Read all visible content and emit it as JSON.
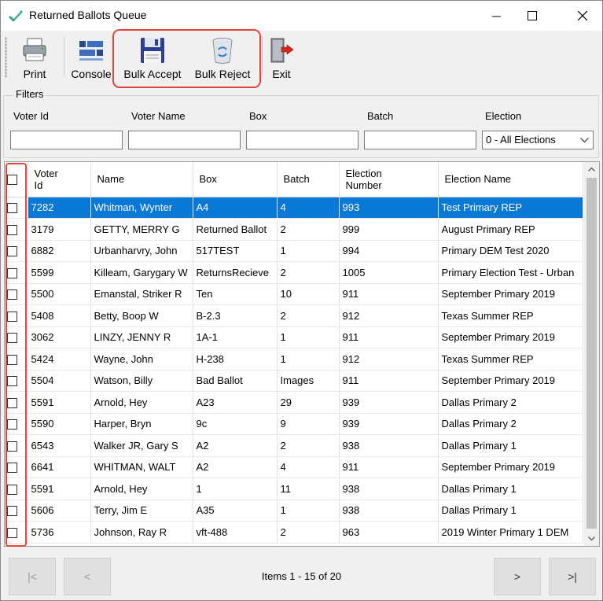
{
  "window": {
    "title": "Returned Ballots Queue"
  },
  "toolbar": {
    "print": "Print",
    "console": "Console",
    "bulk_accept": "Bulk Accept",
    "bulk_reject": "Bulk Reject",
    "exit": "Exit"
  },
  "filters": {
    "legend": "Filters",
    "voter_id_label": "Voter Id",
    "voter_name_label": "Voter Name",
    "box_label": "Box",
    "batch_label": "Batch",
    "election_label": "Election",
    "voter_id_value": "",
    "voter_name_value": "",
    "box_value": "",
    "batch_value": "",
    "election_selected": "0 - All Elections"
  },
  "grid": {
    "headers": {
      "voter_id": "Voter Id",
      "name": "Name",
      "box": "Box",
      "batch": "Batch",
      "election_number": "Election Number",
      "election_name": "Election Name"
    },
    "rows": [
      {
        "voter_id": "7282",
        "name": "Whitman, Wynter",
        "box": "A4",
        "batch": "4",
        "election_number": "993",
        "election_name": "Test Primary REP",
        "selected": true
      },
      {
        "voter_id": "3179",
        "name": "GETTY, MERRY G",
        "box": "Returned Ballot",
        "batch": "2",
        "election_number": "999",
        "election_name": "August Primary REP"
      },
      {
        "voter_id": "6882",
        "name": "Urbanharvry, John",
        "box": "517TEST",
        "batch": "1",
        "election_number": "994",
        "election_name": "Primary DEM Test 2020"
      },
      {
        "voter_id": "5599",
        "name": "Killeam, Garygary W",
        "box": "ReturnsRecieve",
        "batch": "2",
        "election_number": "1005",
        "election_name": "Primary Election Test - Urban"
      },
      {
        "voter_id": "5500",
        "name": "Emanstal, Striker R",
        "box": "Ten",
        "batch": "10",
        "election_number": "911",
        "election_name": "September Primary 2019"
      },
      {
        "voter_id": "5408",
        "name": "Betty, Boop W",
        "box": "B-2.3",
        "batch": "2",
        "election_number": "912",
        "election_name": "Texas Summer REP"
      },
      {
        "voter_id": "3062",
        "name": "LINZY, JENNY R",
        "box": "1A-1",
        "batch": "1",
        "election_number": "911",
        "election_name": "September Primary 2019"
      },
      {
        "voter_id": "5424",
        "name": "Wayne, John",
        "box": "H-238",
        "batch": "1",
        "election_number": "912",
        "election_name": "Texas Summer REP"
      },
      {
        "voter_id": "5504",
        "name": "Watson, Billy",
        "box": "Bad Ballot",
        "batch": "Images",
        "election_number": "911",
        "election_name": "September Primary 2019"
      },
      {
        "voter_id": "5591",
        "name": "Arnold, Hey",
        "box": "A23",
        "batch": "29",
        "election_number": "939",
        "election_name": "Dallas Primary 2"
      },
      {
        "voter_id": "5590",
        "name": "Harper, Bryn",
        "box": "9c",
        "batch": "9",
        "election_number": "939",
        "election_name": "Dallas Primary 2"
      },
      {
        "voter_id": "6543",
        "name": "Walker JR, Gary S",
        "box": "A2",
        "batch": "2",
        "election_number": "938",
        "election_name": "Dallas Primary 1"
      },
      {
        "voter_id": "6641",
        "name": "WHITMAN, WALT",
        "box": "A2",
        "batch": "4",
        "election_number": "911",
        "election_name": "September Primary 2019"
      },
      {
        "voter_id": "5591",
        "name": "Arnold, Hey",
        "box": "1",
        "batch": "11",
        "election_number": "938",
        "election_name": "Dallas Primary 1"
      },
      {
        "voter_id": "5606",
        "name": "Terry, Jim E",
        "box": "A35",
        "batch": "1",
        "election_number": "938",
        "election_name": "Dallas Primary 1"
      },
      {
        "voter_id": "5736",
        "name": "Johnson, Ray R",
        "box": "vft-488",
        "batch": "2",
        "election_number": "963",
        "election_name": "2019 Winter Primary 1 DEM"
      }
    ]
  },
  "pager": {
    "first": "|<",
    "prev": "<",
    "status": "Items 1 - 15 of 20",
    "next": ">",
    "last": ">|"
  },
  "colors": {
    "selection": "#0a78d7",
    "highlight": "#e0463c"
  }
}
